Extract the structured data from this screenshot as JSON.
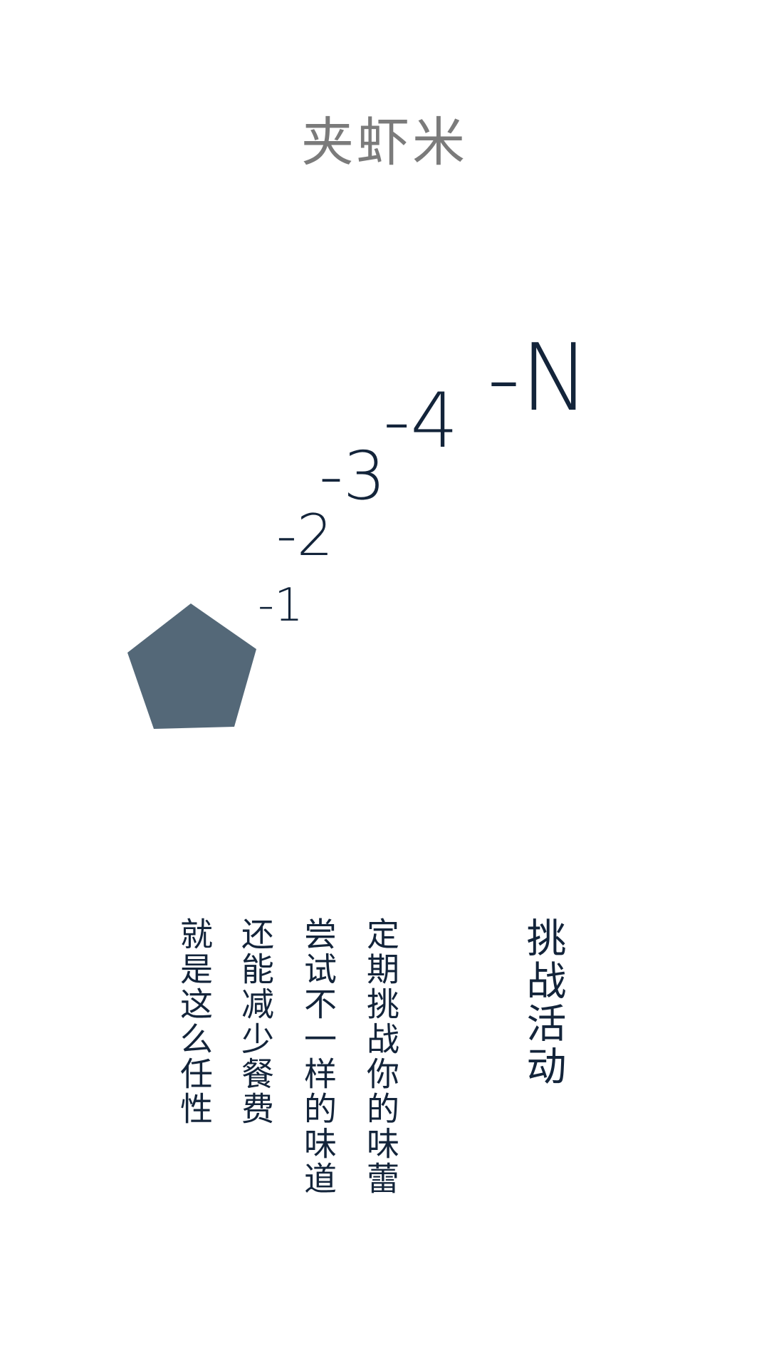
{
  "header": {
    "title": "夹虾米"
  },
  "steps": [
    "-1",
    "-2",
    "-3",
    "-4",
    "-N"
  ],
  "shape": {
    "icon": "pentagon-icon",
    "color": "#546878"
  },
  "content": {
    "heading": "挑战活动",
    "lines": [
      "定期挑战你的味蕾",
      "尝试不一样的味道",
      "还能减少餐费",
      "就是这么任性"
    ]
  },
  "colors": {
    "text_dark": "#13243a",
    "title_gray": "#7b7b7b"
  }
}
